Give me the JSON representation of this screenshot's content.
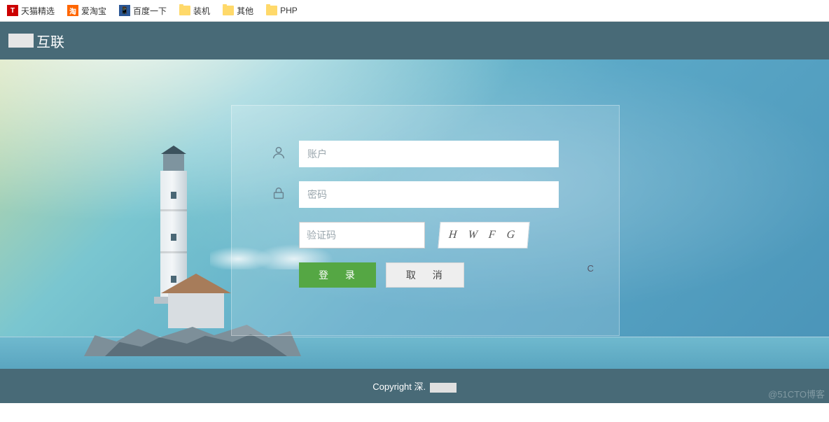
{
  "bookmarks": [
    {
      "label": "天猫精选",
      "icon": "T",
      "iconStyle": "bm-red"
    },
    {
      "label": "爱淘宝",
      "icon": "淘",
      "iconStyle": "bm-orange"
    },
    {
      "label": "百度一下",
      "icon": "📱",
      "iconStyle": "bm-blue"
    },
    {
      "label": "装机",
      "icon": "folder",
      "iconStyle": "bm-folder"
    },
    {
      "label": "其他",
      "icon": "folder",
      "iconStyle": "bm-folder"
    },
    {
      "label": "PHP",
      "icon": "folder",
      "iconStyle": "bm-folder"
    }
  ],
  "header": {
    "brand_suffix": "互联"
  },
  "login": {
    "username_placeholder": "账户",
    "password_placeholder": "密码",
    "captcha_placeholder": "验证码",
    "captcha_text": "H W F G",
    "login_label": "登 录",
    "cancel_label": "取 消",
    "refresh_char": "C"
  },
  "footer": {
    "copyright_prefix": "Copyright 深."
  },
  "watermark": "@51CTO博客"
}
